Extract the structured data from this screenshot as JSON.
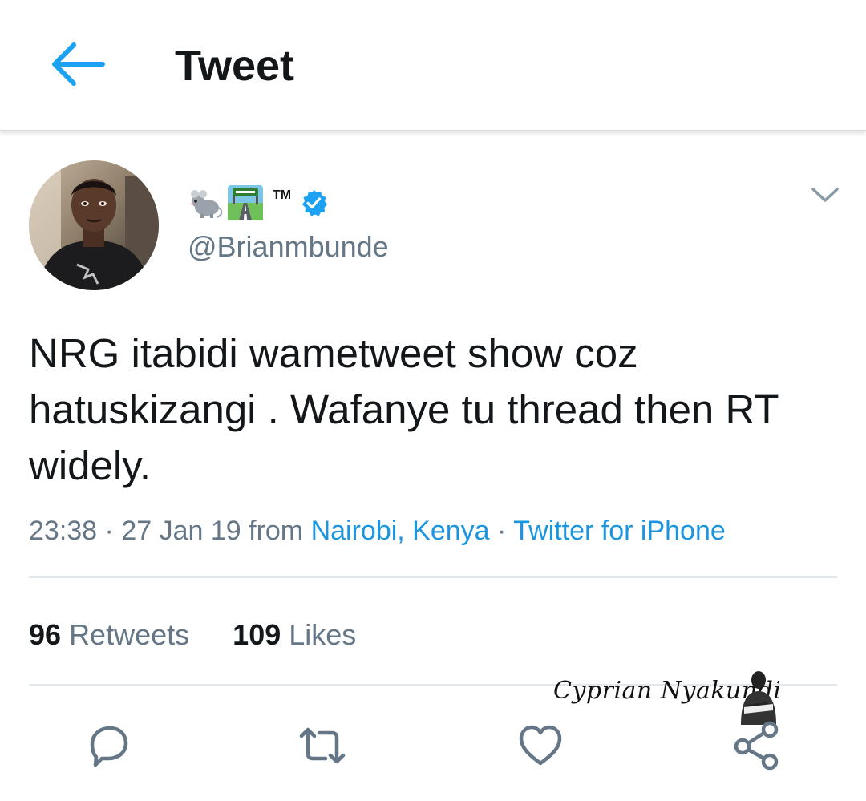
{
  "header": {
    "title": "Tweet",
    "back_icon": "arrow-left-icon"
  },
  "tweet": {
    "tm_mark": "TM",
    "name_emojis": [
      "mouse-emoji",
      "motorway-emoji"
    ],
    "handle": "@Brianmbunde",
    "text": "NRG itabidi wametweet show coz hatuskizangi . Wafanye tu thread then RT widely.",
    "meta": {
      "time": "23:38",
      "sep1": " · ",
      "date": "27 Jan 19",
      "from_label": " from ",
      "location": "Nairobi, Kenya",
      "sep2": " · ",
      "source": "Twitter for iPhone"
    },
    "stats": {
      "retweets_count": "96",
      "retweets_label": "Retweets",
      "likes_count": "109",
      "likes_label": "Likes"
    }
  },
  "actions": [
    "reply-icon",
    "retweet-icon",
    "like-icon",
    "share-icon"
  ],
  "watermark": {
    "text": "Cyprian Nyakundi"
  },
  "colors": {
    "accent": "#1da1f2",
    "link": "#1b95e0",
    "secondary_text": "#657786",
    "icon_gray": "#657786",
    "divider": "#e1e8ed"
  }
}
